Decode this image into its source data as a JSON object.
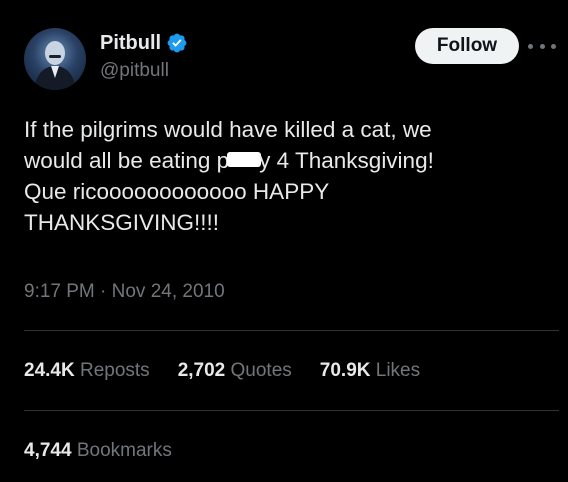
{
  "author": {
    "display_name": "Pitbull",
    "handle": "@pitbull",
    "verified": true
  },
  "follow_button": {
    "label": "Follow"
  },
  "tweet": {
    "text_before": "If the pilgrims would have killed a cat, we\nwould all be eating p",
    "text_after": "y 4 Thanksgiving!\nQue ricoooooooooooo HAPPY\nTHANKSGIVING!!!!",
    "timestamp": "9:17 PM · Nov 24, 2010"
  },
  "stats": {
    "reposts_count": "24.4K",
    "reposts_label": "Reposts",
    "quotes_count": "2,702",
    "quotes_label": "Quotes",
    "likes_count": "70.9K",
    "likes_label": "Likes",
    "bookmarks_count": "4,744",
    "bookmarks_label": "Bookmarks"
  },
  "colors": {
    "background": "#000000",
    "text_primary": "#e7e9ea",
    "text_secondary": "#71767b",
    "divider": "#2f3336",
    "verified_badge": "#1d9bf0",
    "follow_button_bg": "#eff3f4"
  },
  "icons": {
    "verified": "verified-badge-icon",
    "more": "more-options-icon"
  }
}
